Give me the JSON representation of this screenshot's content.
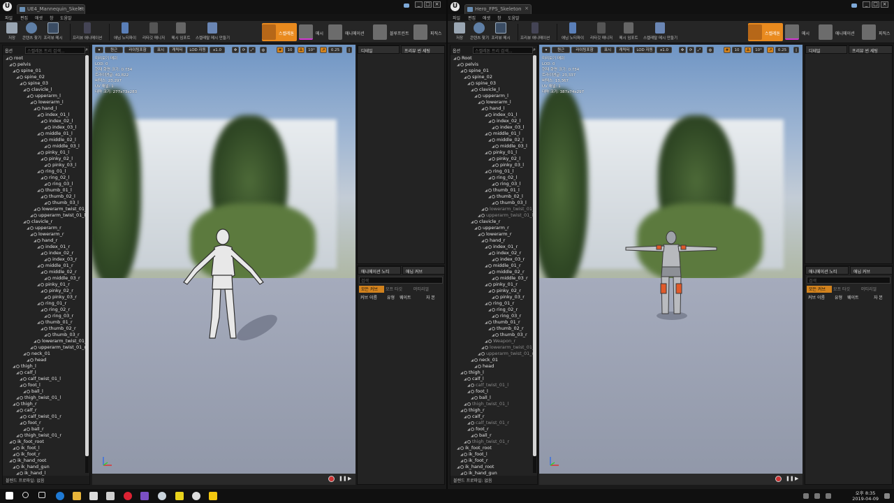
{
  "left_window": {
    "tab_title": "UE4_Mannequin_Skeleton",
    "menu": [
      "파일",
      "편집",
      "애셋",
      "창",
      "도움말"
    ],
    "toolbar": [
      "저장",
      "콘텐츠 찾기",
      "프리뷰 메시",
      "프리뷰 애니메이션",
      "애님 노티파이",
      "리타깃 매니저",
      "메시 임포트",
      "스켈레탈 메시 만들기"
    ],
    "modes": [
      "스켈레톤",
      "메시",
      "애니메이션",
      "블루프린트",
      "피직스"
    ],
    "tree_search_label": "옵션",
    "tree_search_placeholder": "스켈레톤 트리 검색...",
    "tree_footer": "블렌드 프로파일: 없음",
    "vp_buttons": [
      "원근",
      "라이팅포함",
      "표시",
      "캐릭터",
      "LOD 자동",
      "x1.0",
      "10",
      "10°",
      "0.25"
    ],
    "stats": [
      "미리보기 메쉬",
      "LOD: 0",
      "현재 화면 크기: 0.734",
      "트라이앵글: 41,822",
      "버텍스: 23,297",
      "UV 채널: 1",
      "대략 크기: 277x73x283"
    ],
    "details_tab": "디테일",
    "preview_tab": "프리뷰 씬 세팅",
    "anim_tab": "애니메이션 노티",
    "curve_tab": "애님 커브",
    "curve_search": "검색",
    "curve_filters": [
      "모든 커브",
      "모프 타깃",
      "머티리얼"
    ],
    "curve_cols": [
      "커브 이름",
      "유형",
      "웨이트",
      "자 본"
    ]
  },
  "right_window": {
    "tab_title": "Hero_FPS_Skeleton",
    "tree_footer": "블렌드 프로파일: 없음",
    "vp_buttons": [
      "원근",
      "라이팅포함",
      "표시",
      "캐릭터",
      "LOD 자동",
      "x1.0",
      "10",
      "10°",
      "0.25"
    ],
    "stats": [
      "미리보기 메쉬",
      "LOD: 0",
      "현재 화면 크기: 0.734",
      "트라이앵글: 23,337",
      "버텍스: 13,367",
      "UV 채널: 1",
      "대략 크기: 387x74x297"
    ]
  },
  "left_tree": [
    [
      "root",
      0
    ],
    [
      "pelvis",
      1
    ],
    [
      "spine_01",
      2
    ],
    [
      "spine_02",
      3
    ],
    [
      "spine_03",
      4
    ],
    [
      "clavicle_l",
      5
    ],
    [
      "upperarm_l",
      6
    ],
    [
      "lowerarm_l",
      7
    ],
    [
      "hand_l",
      8
    ],
    [
      "index_01_l",
      9
    ],
    [
      "index_02_l",
      10
    ],
    [
      "index_03_l",
      11
    ],
    [
      "middle_01_l",
      9
    ],
    [
      "middle_02_l",
      10
    ],
    [
      "middle_03_l",
      11
    ],
    [
      "pinky_01_l",
      9
    ],
    [
      "pinky_02_l",
      10
    ],
    [
      "pinky_03_l",
      11
    ],
    [
      "ring_01_l",
      9
    ],
    [
      "ring_02_l",
      10
    ],
    [
      "ring_03_l",
      11
    ],
    [
      "thumb_01_l",
      9
    ],
    [
      "thumb_02_l",
      10
    ],
    [
      "thumb_03_l",
      11
    ],
    [
      "lowerarm_twist_01_l",
      8
    ],
    [
      "upperarm_twist_01_l",
      7
    ],
    [
      "clavicle_r",
      5
    ],
    [
      "upperarm_r",
      6
    ],
    [
      "lowerarm_r",
      7
    ],
    [
      "hand_r",
      8
    ],
    [
      "index_01_r",
      9
    ],
    [
      "index_02_r",
      10
    ],
    [
      "index_03_r",
      11
    ],
    [
      "middle_01_r",
      9
    ],
    [
      "middle_02_r",
      10
    ],
    [
      "middle_03_r",
      11
    ],
    [
      "pinky_01_r",
      9
    ],
    [
      "pinky_02_r",
      10
    ],
    [
      "pinky_03_r",
      11
    ],
    [
      "ring_01_r",
      9
    ],
    [
      "ring_02_r",
      10
    ],
    [
      "ring_03_r",
      11
    ],
    [
      "thumb_01_r",
      9
    ],
    [
      "thumb_02_r",
      10
    ],
    [
      "thumb_03_r",
      11
    ],
    [
      "lowerarm_twist_01_r",
      8
    ],
    [
      "upperarm_twist_01_r",
      7
    ],
    [
      "neck_01",
      5
    ],
    [
      "head",
      6
    ],
    [
      "thigh_l",
      2
    ],
    [
      "calf_l",
      3
    ],
    [
      "calf_twist_01_l",
      4
    ],
    [
      "foot_l",
      4
    ],
    [
      "ball_l",
      5
    ],
    [
      "thigh_twist_01_l",
      3
    ],
    [
      "thigh_r",
      2
    ],
    [
      "calf_r",
      3
    ],
    [
      "calf_twist_01_r",
      4
    ],
    [
      "foot_r",
      4
    ],
    [
      "ball_r",
      5
    ],
    [
      "thigh_twist_01_r",
      3
    ],
    [
      "ik_foot_root",
      1
    ],
    [
      "ik_foot_l",
      2
    ],
    [
      "ik_foot_r",
      2
    ],
    [
      "ik_hand_root",
      1
    ],
    [
      "ik_hand_gun",
      2
    ],
    [
      "ik_hand_l",
      3
    ]
  ],
  "right_tree": [
    [
      "Root",
      0
    ],
    [
      "pelvis",
      1
    ],
    [
      "spine_01",
      2
    ],
    [
      "spine_02",
      3
    ],
    [
      "spine_03",
      4
    ],
    [
      "clavicle_l",
      5
    ],
    [
      "upperarm_l",
      6
    ],
    [
      "lowerarm_l",
      7
    ],
    [
      "hand_l",
      8
    ],
    [
      "index_01_l",
      9
    ],
    [
      "index_02_l",
      10
    ],
    [
      "index_03_l",
      11
    ],
    [
      "middle_01_l",
      9
    ],
    [
      "middle_02_l",
      10
    ],
    [
      "middle_03_l",
      11
    ],
    [
      "pinky_01_l",
      9
    ],
    [
      "pinky_02_l",
      10
    ],
    [
      "pinky_03_l",
      11
    ],
    [
      "ring_01_l",
      9
    ],
    [
      "ring_02_l",
      10
    ],
    [
      "ring_03_l",
      11
    ],
    [
      "thumb_01_l",
      9
    ],
    [
      "thumb_02_l",
      10
    ],
    [
      "thumb_03_l",
      11
    ],
    [
      "lowerarm_twist_01_l",
      8
    ],
    [
      "upperarm_twist_01_l",
      7
    ],
    [
      "clavicle_r",
      5
    ],
    [
      "upperarm_r",
      6
    ],
    [
      "lowerarm_r",
      7
    ],
    [
      "hand_r",
      8
    ],
    [
      "index_01_r",
      9
    ],
    [
      "index_02_r",
      10
    ],
    [
      "index_03_r",
      11
    ],
    [
      "middle_01_r",
      9
    ],
    [
      "middle_02_r",
      10
    ],
    [
      "middle_03_r",
      11
    ],
    [
      "pinky_01_r",
      9
    ],
    [
      "pinky_02_r",
      10
    ],
    [
      "pinky_03_r",
      11
    ],
    [
      "ring_01_r",
      9
    ],
    [
      "ring_02_r",
      10
    ],
    [
      "ring_03_r",
      11
    ],
    [
      "thumb_01_r",
      9
    ],
    [
      "thumb_02_r",
      10
    ],
    [
      "thumb_03_r",
      11
    ],
    [
      "Weapon_r",
      9
    ],
    [
      "lowerarm_twist_01_r",
      8
    ],
    [
      "upperarm_twist_01_r",
      7
    ],
    [
      "neck_01",
      5
    ],
    [
      "head",
      6
    ],
    [
      "thigh_l",
      2
    ],
    [
      "calf_l",
      3
    ],
    [
      "calf_twist_01_l",
      4
    ],
    [
      "foot_l",
      4
    ],
    [
      "ball_l",
      5
    ],
    [
      "thigh_twist_01_l",
      3
    ],
    [
      "thigh_r",
      2
    ],
    [
      "calf_r",
      3
    ],
    [
      "calf_twist_01_r",
      4
    ],
    [
      "foot_r",
      4
    ],
    [
      "ball_r",
      5
    ],
    [
      "thigh_twist_01_r",
      3
    ],
    [
      "ik_foot_root",
      1
    ],
    [
      "ik_foot_l",
      2
    ],
    [
      "ik_foot_r",
      2
    ],
    [
      "ik_hand_root",
      1
    ],
    [
      "ik_hand_gun",
      2
    ]
  ],
  "clock": {
    "time": "오후 8:35",
    "date": "2019-04-09"
  },
  "colors": {
    "accent": "#e98a1e",
    "viewport_floor": "#9a9fb0"
  }
}
